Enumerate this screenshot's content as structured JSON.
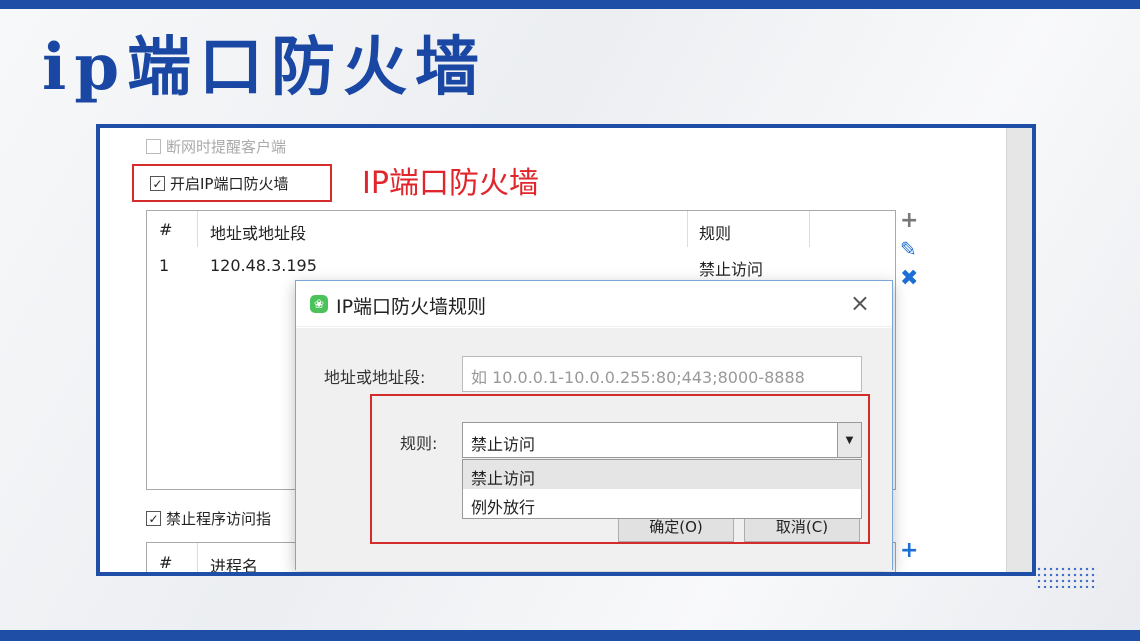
{
  "slide": {
    "title": "ip端口防火墙"
  },
  "settings": {
    "remind_disconnect_label": "断网时提醒客户端",
    "enable_firewall_label": "开启IP端口防火墙",
    "annotation": "IP端口防火墙",
    "ban_program_label": "禁止程序访问指"
  },
  "ip_table": {
    "headers": [
      "#",
      "地址或地址段",
      "规则"
    ],
    "rows": [
      {
        "index": "1",
        "address": "120.48.3.195",
        "rule": "禁止访问"
      }
    ]
  },
  "process_table": {
    "headers": [
      "#",
      "进程名"
    ]
  },
  "dialog": {
    "title": "IP端口防火墙规则",
    "close": "×",
    "address_label": "地址或地址段:",
    "address_placeholder": "如 10.0.0.1-10.0.0.255:80;443;8000-8888",
    "rule_label": "规则:",
    "rule_selected": "禁止访问",
    "rule_options": [
      "禁止访问",
      "例外放行"
    ],
    "ok_label": "确定(O)",
    "cancel_label": "取消(C)"
  },
  "icons": {
    "add": "+",
    "edit": "✎",
    "delete": "✖",
    "checkmark": "✓",
    "dropdown_arrow": "▼"
  },
  "colors": {
    "brand_blue": "#1e4ea6",
    "annotation_red": "#e0262d",
    "toolbar_blue": "#1d6fd6"
  }
}
